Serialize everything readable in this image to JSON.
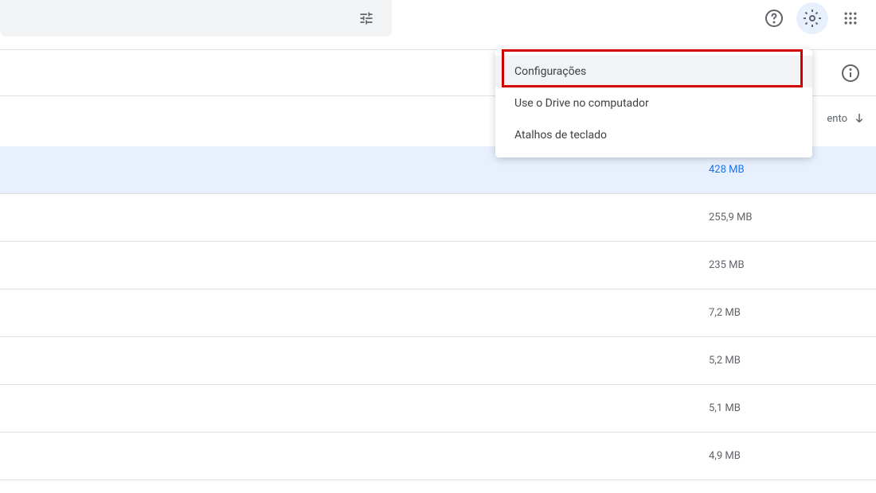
{
  "menu": {
    "items": [
      {
        "label": "Configurações"
      },
      {
        "label": "Use o Drive no computador"
      },
      {
        "label": "Atalhos de teclado"
      }
    ]
  },
  "sortHeader": {
    "label": "ento"
  },
  "files": [
    {
      "size": "428 MB",
      "selected": true
    },
    {
      "size": "255,9 MB",
      "selected": false
    },
    {
      "size": "235 MB",
      "selected": false
    },
    {
      "size": "7,2 MB",
      "selected": false
    },
    {
      "size": "5,2 MB",
      "selected": false
    },
    {
      "size": "5,1 MB",
      "selected": false
    },
    {
      "size": "4,9 MB",
      "selected": false
    }
  ]
}
